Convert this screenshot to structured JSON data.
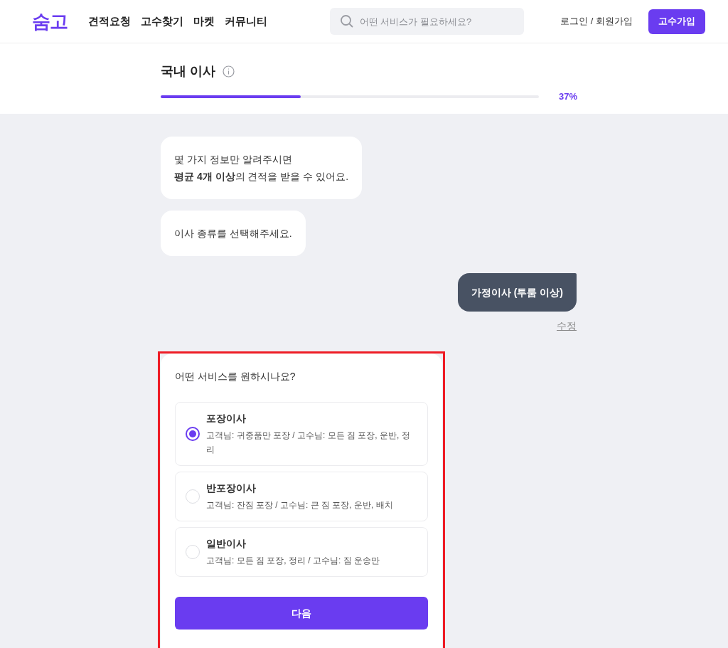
{
  "header": {
    "logo": "숨고",
    "nav": [
      "견적요청",
      "고수찾기",
      "마켓",
      "커뮤니티"
    ],
    "search": {
      "placeholder": "어떤 서비스가 필요하세요?"
    },
    "login": "로그인 / 회원가입",
    "signup": "고수가입"
  },
  "progress": {
    "title": "국내 이사",
    "level": 0.37,
    "reading": "37%"
  },
  "chat": [
    {
      "kind": "bot",
      "text": [
        "몇 가지 정보만 알려주시면",
        "**평균 4개 이상**의 견적을 받을 수 있어요."
      ]
    },
    {
      "kind": "bot",
      "text": [
        "이사 종류를 선택해주세요."
      ]
    },
    {
      "kind": "user",
      "text": [
        "가정이사 (투룸 이상)"
      ],
      "edit": "수정"
    }
  ],
  "question": {
    "highlighted": true,
    "title": "어떤 서비스를 원하시나요?",
    "options": [
      {
        "label": "포장이사",
        "description": "고객님: 귀중품만 포장 / 고수님: 모든 짐 포장, 운반, 정리",
        "selected": true
      },
      {
        "label": "반포장이사",
        "description": "고객님: 잔짐 포장 / 고수님: 큰 짐 포장, 운반, 배치",
        "selected": false
      },
      {
        "label": "일반이사",
        "description": "고객님: 모든 짐 포장, 정리 / 고수님: 짐 운송만",
        "selected": false
      }
    ],
    "next": "다음"
  }
}
